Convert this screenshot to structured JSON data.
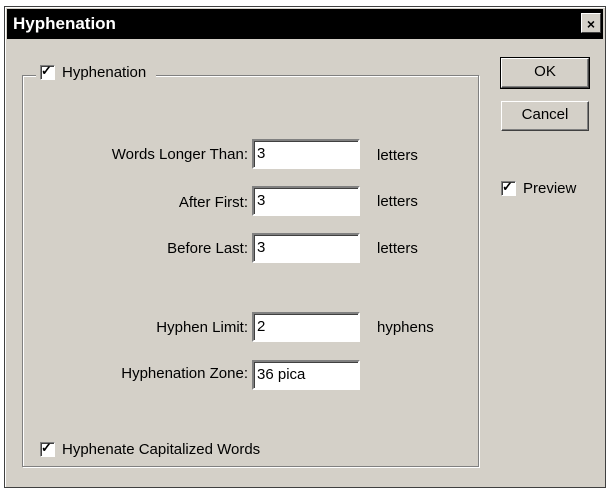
{
  "window": {
    "title": "Hyphenation",
    "close_glyph": "×"
  },
  "hyphenation_toggle": {
    "label": "Hyphenation",
    "checked": true,
    "check_glyph": "✓"
  },
  "fields": {
    "words_longer_than": {
      "label": "Words Longer Than:",
      "value": "3",
      "unit": "letters"
    },
    "after_first": {
      "label": "After First:",
      "value": "3",
      "unit": "letters"
    },
    "before_last": {
      "label": "Before Last:",
      "value": "3",
      "unit": "letters"
    },
    "hyphen_limit": {
      "label": "Hyphen Limit:",
      "value": "2",
      "unit": "hyphens"
    },
    "hyphenation_zone": {
      "label": "Hyphenation Zone:",
      "value": "36 pica"
    }
  },
  "capitalized": {
    "label": "Hyphenate Capitalized Words",
    "checked": true
  },
  "buttons": {
    "ok": "OK",
    "cancel": "Cancel"
  },
  "preview": {
    "label": "Preview",
    "checked": true
  }
}
